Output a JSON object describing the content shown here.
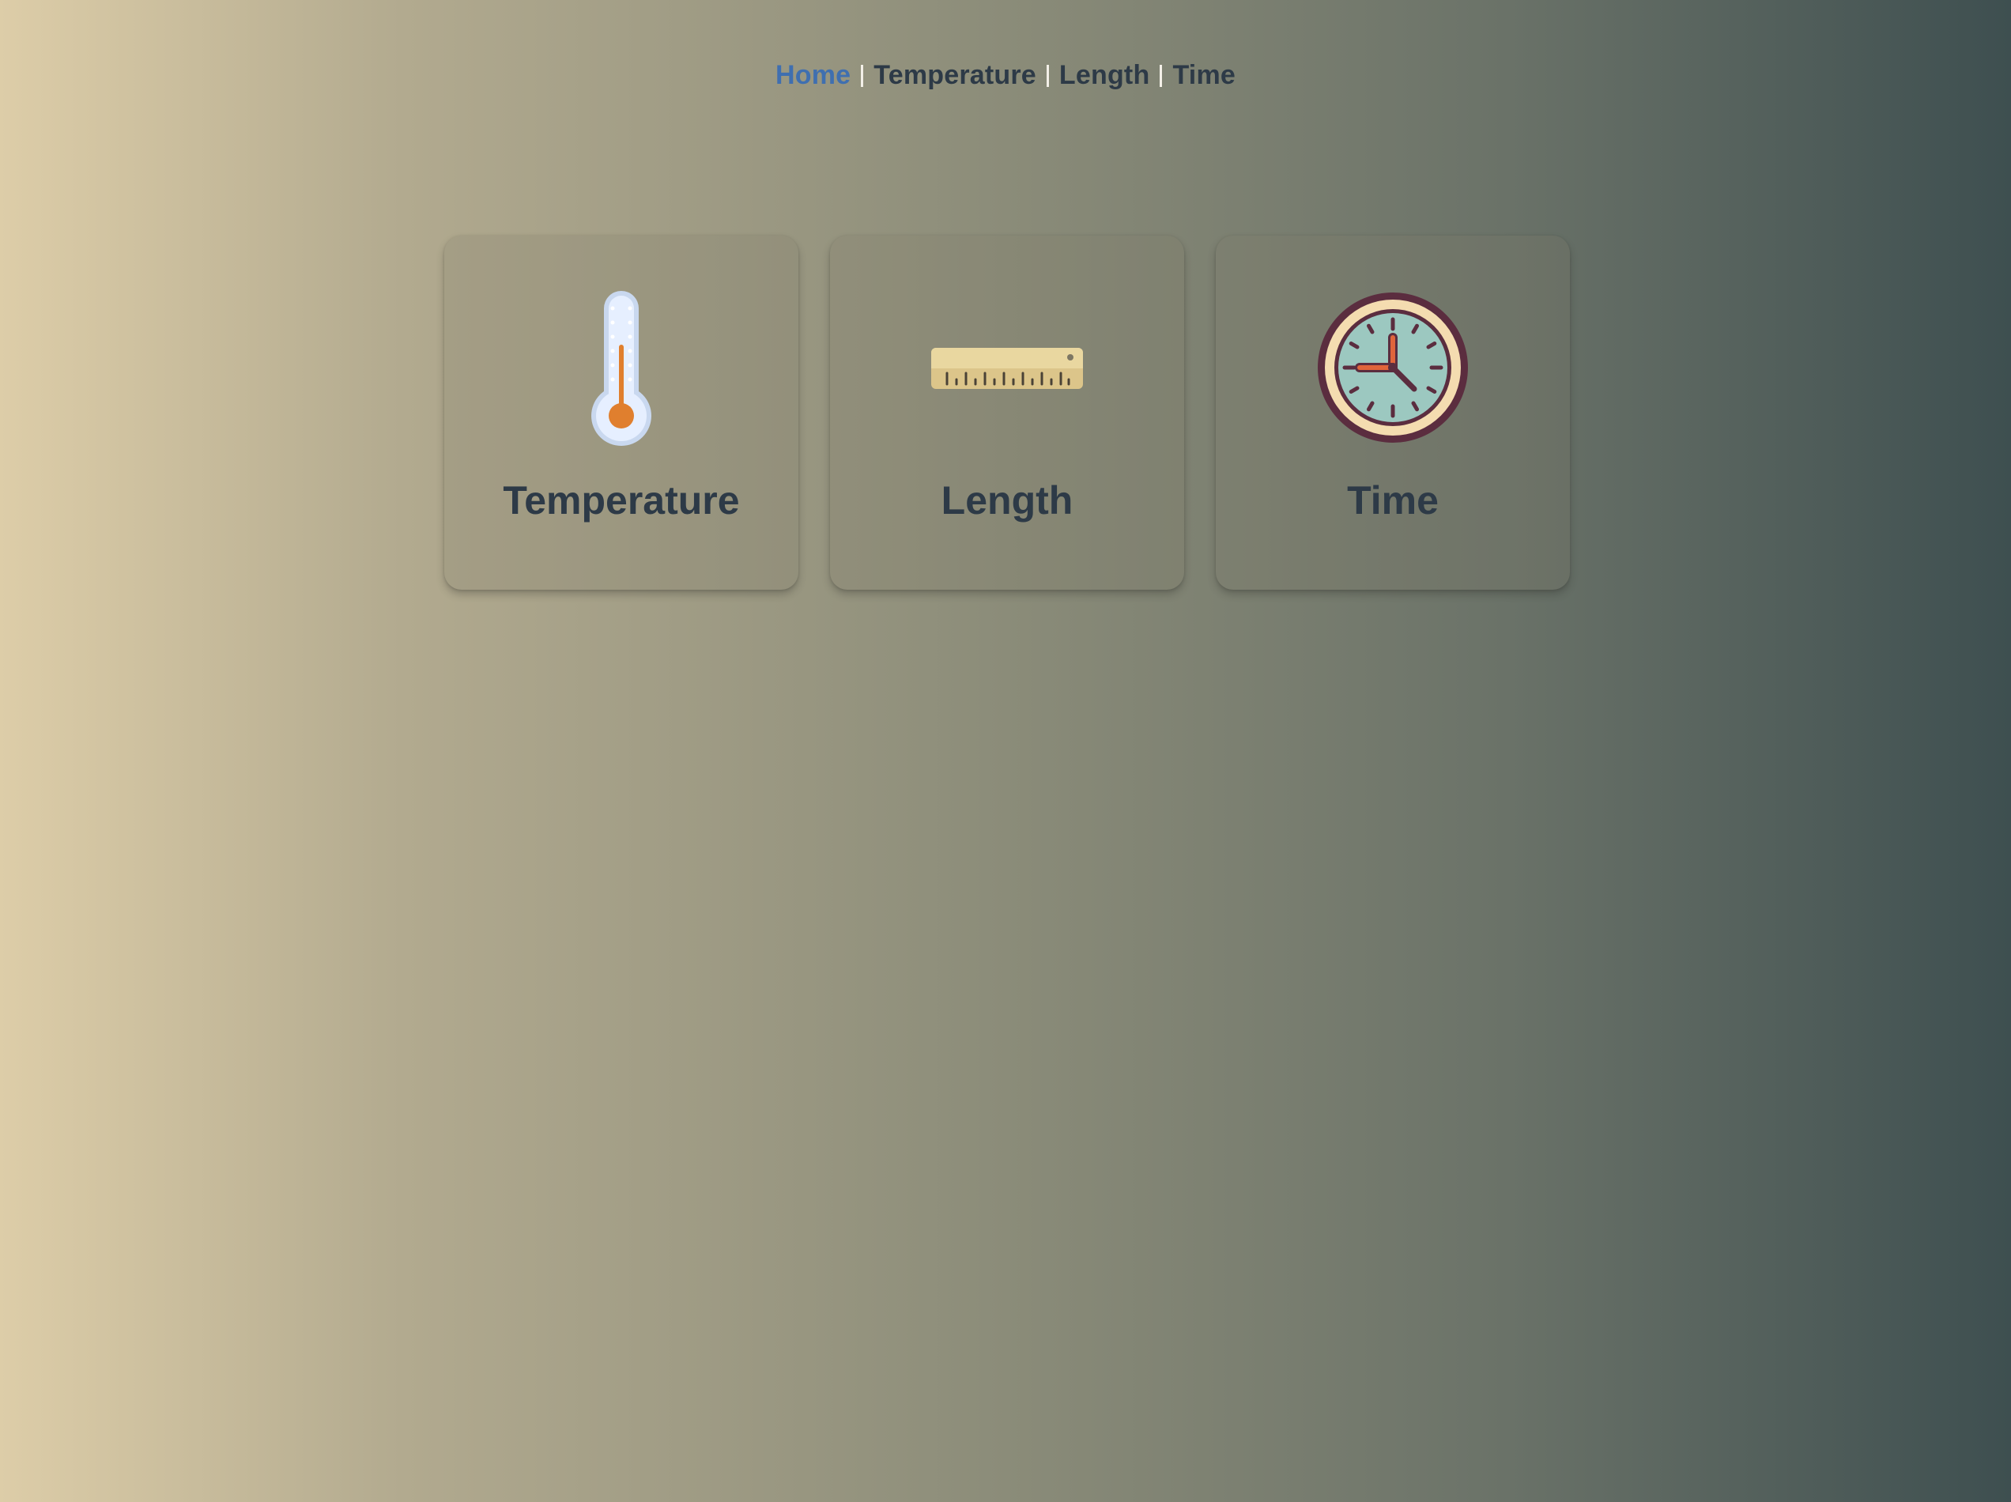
{
  "nav": {
    "items": [
      {
        "label": "Home",
        "active": true
      },
      {
        "label": "Temperature",
        "active": false
      },
      {
        "label": "Length",
        "active": false
      },
      {
        "label": "Time",
        "active": false
      }
    ]
  },
  "cards": [
    {
      "label": "Temperature",
      "icon": "thermometer-icon"
    },
    {
      "label": "Length",
      "icon": "ruler-icon"
    },
    {
      "label": "Time",
      "icon": "clock-icon"
    }
  ],
  "colors": {
    "nav_active": "#3f6fb0",
    "text": "#2d3a47",
    "background_start": "#ddcda8",
    "background_end": "#3e4f50"
  }
}
